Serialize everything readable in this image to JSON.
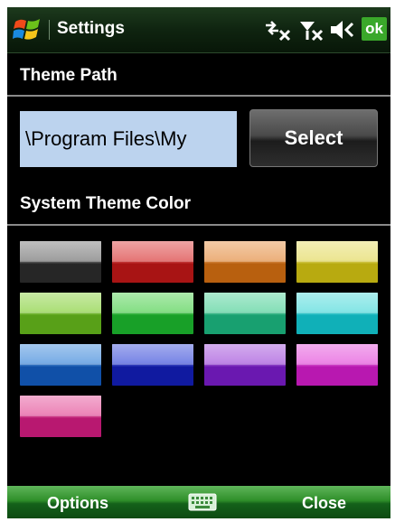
{
  "title_bar": {
    "title": "Settings",
    "ok_label": "ok",
    "icons": [
      "windows-start-icon",
      "connectivity-icon",
      "signal-off-icon",
      "volume-off-icon"
    ]
  },
  "theme_path": {
    "label": "Theme Path",
    "value": "\\Program Files\\My",
    "select_label": "Select"
  },
  "system_theme": {
    "label": "System Theme Color",
    "colors": [
      {
        "top": "#8a8a8a",
        "bottom": "#262626"
      },
      {
        "top": "#e05a5a",
        "bottom": "#a81414"
      },
      {
        "top": "#e8a060",
        "bottom": "#b8600f"
      },
      {
        "top": "#e8e07a",
        "bottom": "#b8aa10"
      },
      {
        "top": "#9ad85a",
        "bottom": "#58a018"
      },
      {
        "top": "#6ad86a",
        "bottom": "#18a028"
      },
      {
        "top": "#6ad8a8",
        "bottom": "#18a070"
      },
      {
        "top": "#6ae0e0",
        "bottom": "#10b0b8"
      },
      {
        "top": "#5a9ae0",
        "bottom": "#1050a8"
      },
      {
        "top": "#5a6ae0",
        "bottom": "#101aa0"
      },
      {
        "top": "#b06ae0",
        "bottom": "#6a18b0"
      },
      {
        "top": "#e86ae0",
        "bottom": "#b818b0"
      },
      {
        "top": "#e86aa8",
        "bottom": "#b81870"
      }
    ]
  },
  "bottom_bar": {
    "left_label": "Options",
    "right_label": "Close",
    "icon": "keyboard-icon"
  }
}
